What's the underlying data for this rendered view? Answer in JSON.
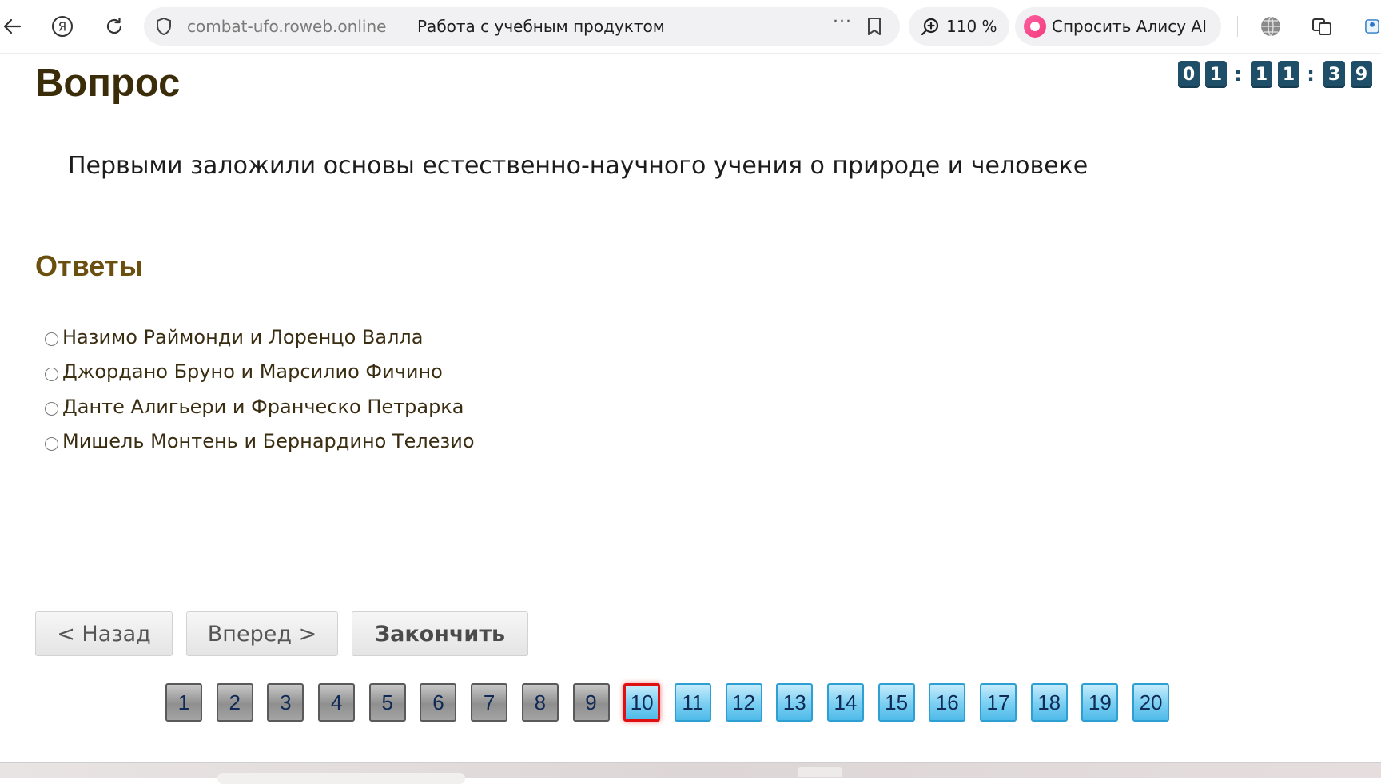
{
  "browser": {
    "url": "combat-ufo.roweb.online",
    "page_title": "Работа с учебным продуктом",
    "more_label": "···",
    "zoom": "110 %",
    "alice_label": "Спросить Алису AI"
  },
  "timer": {
    "digits": [
      "0",
      "1",
      "1",
      "1",
      "3",
      "9"
    ],
    "separator": ":"
  },
  "question": {
    "heading": "Вопрос",
    "text": "Первыми заложили основы естественно-научного учения о природе и человеке"
  },
  "answers": {
    "heading": "Ответы",
    "options": [
      "Назимо Раймонди и Лоренцо Валла",
      "Джордано Бруно и Марсилио Фичино",
      "Данте Алигьери и Франческо Петрарка",
      "Мишель Монтень и Бернардино Телезио"
    ]
  },
  "nav": {
    "back": "< Назад",
    "forward": "Вперед >",
    "finish": "Закончить"
  },
  "pager": {
    "numbers": [
      "1",
      "2",
      "3",
      "4",
      "5",
      "6",
      "7",
      "8",
      "9",
      "10",
      "11",
      "12",
      "13",
      "14",
      "15",
      "16",
      "17",
      "18",
      "19",
      "20"
    ],
    "current": "10",
    "answered_count": 9
  }
}
